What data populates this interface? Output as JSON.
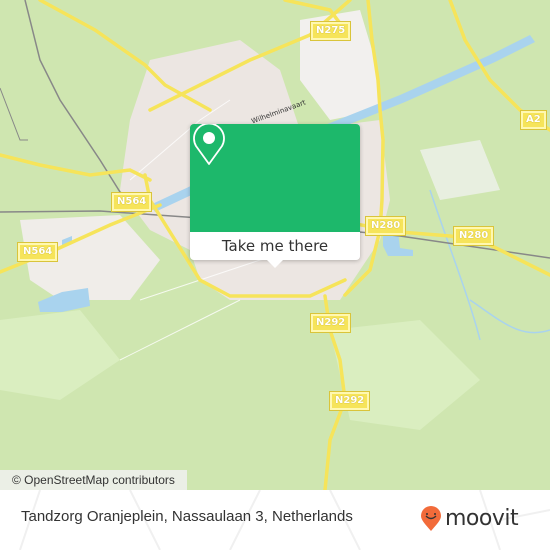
{
  "map": {
    "road_labels": [
      {
        "id": "n275",
        "text": "N275"
      },
      {
        "id": "a2",
        "text": "A2"
      },
      {
        "id": "n564-east",
        "text": "N564"
      },
      {
        "id": "n564-west",
        "text": "N564"
      },
      {
        "id": "n280-west",
        "text": "N280"
      },
      {
        "id": "n280-east",
        "text": "N280"
      },
      {
        "id": "n292-north",
        "text": "N292"
      },
      {
        "id": "n292-south",
        "text": "N292"
      }
    ],
    "canal_label": "Wilhelminavaart",
    "attribution": "© OpenStreetMap contributors",
    "colors": {
      "land": "#cfe6b0",
      "urban": "#ece6e2",
      "water": "#a9d3ee",
      "road": "#f6e45a",
      "rail": "#888888"
    }
  },
  "popup": {
    "icon": "map-pin-icon",
    "button_label": "Take me there",
    "accent_color": "#1db86b"
  },
  "footer": {
    "address": "Tandzorg Oranjeplein, Nassaulaan 3, Netherlands",
    "brand": "moovit",
    "brand_icon": "moovit-smile-pin-icon",
    "brand_color": "#f26b3a"
  }
}
